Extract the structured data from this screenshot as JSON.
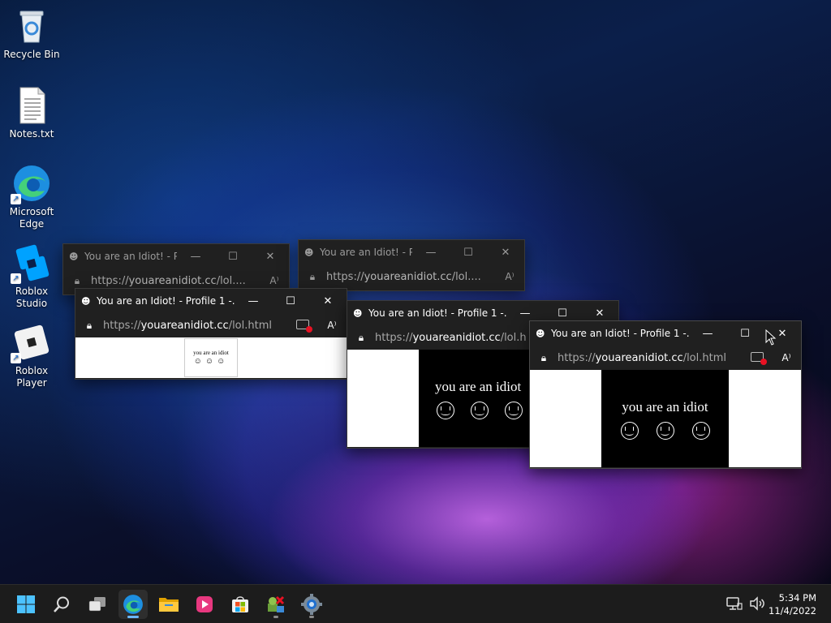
{
  "desktop_icons": [
    {
      "label": "Recycle Bin",
      "icon": "recycle-bin-icon"
    },
    {
      "label": "Notes.txt",
      "icon": "text-file-icon"
    },
    {
      "label": "Microsoft Edge",
      "icon": "edge-icon"
    },
    {
      "label": "Roblox Studio",
      "icon": "roblox-studio-icon"
    },
    {
      "label": "Roblox Player",
      "icon": "roblox-player-icon"
    }
  ],
  "windows": [
    {
      "title": "You are an Idiot! - P...",
      "url_prefix": "https://",
      "url_domain": "youareanidiot.cc",
      "url_path": "/lol....",
      "page_text": ""
    },
    {
      "title": "You are an Idiot! - P...",
      "url_prefix": "https://",
      "url_domain": "youareanidiot.cc",
      "url_path": "/lol....",
      "page_text": ""
    },
    {
      "title": "You are an Idiot! - Profile 1 -...",
      "url_prefix": "https://",
      "url_domain": "youareanidiot.cc",
      "url_path": "/lol.html",
      "page_text": "you are an idiot"
    },
    {
      "title": "You are an Idiot! - Profile 1 -...",
      "url_prefix": "https://",
      "url_domain": "youareanidiot.cc",
      "url_path": "/lol.h",
      "page_text": "you are an idiot"
    },
    {
      "title": "You are an Idiot! - Profile 1 -...",
      "url_prefix": "https://",
      "url_domain": "youareanidiot.cc",
      "url_path": "/lol.html",
      "page_text": "you are an idiot"
    }
  ],
  "window_controls": {
    "minimize": "—",
    "maximize": "☐",
    "close": "✕"
  },
  "taskbar": {
    "items": [
      "windows-start-icon",
      "search-icon",
      "task-view-icon",
      "edge-icon",
      "file-explorer-icon",
      "media-player-icon",
      "microsoft-store-icon",
      "virus-app-icon",
      "settings-gear-icon"
    ],
    "time": "5:34 PM",
    "date": "11/4/2022"
  },
  "colors": {
    "edge_blue": "#1d8fe0",
    "taskbar_bg": "#1c1c1c",
    "active_pip": "#6cb8ff"
  }
}
